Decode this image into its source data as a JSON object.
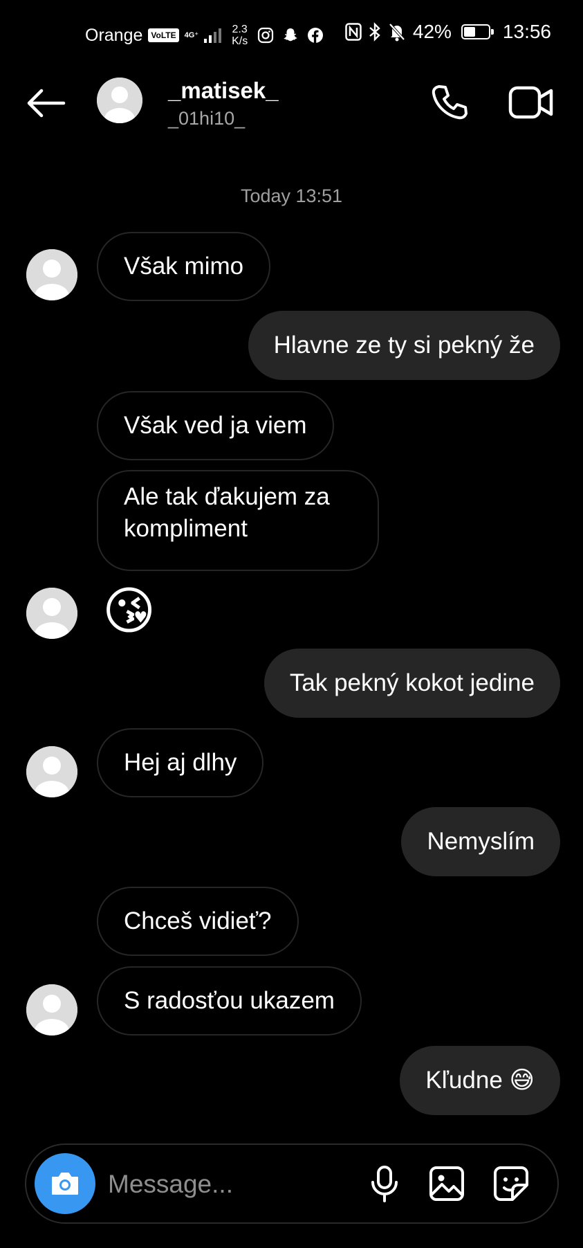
{
  "status_bar": {
    "carrier": "Orange",
    "volte": "VoLTE",
    "network": "4G⁺",
    "speed_value": "2.3",
    "speed_unit": "K/s",
    "battery_percent": "42%",
    "battery_level": 0.42,
    "time": "13:56"
  },
  "header": {
    "name": "_matisek_",
    "username": "_01hi10_"
  },
  "conversation": {
    "timestamp": "Today 13:51",
    "messages": [
      {
        "dir": "in",
        "text": "Však mimo"
      },
      {
        "dir": "out",
        "text": "Hlavne ze ty si pekný že"
      },
      {
        "dir": "in",
        "text": "Však ved ja viem"
      },
      {
        "dir": "in",
        "text": "Ale tak ďakujem za kompliment"
      },
      {
        "dir": "in",
        "text": "😘"
      },
      {
        "dir": "out",
        "text": "Tak pekný kokot jedine"
      },
      {
        "dir": "in",
        "text": "Hej aj dlhy"
      },
      {
        "dir": "out",
        "text": "Nemyslím"
      },
      {
        "dir": "in",
        "text": "Chceš vidieť?"
      },
      {
        "dir": "in",
        "text": "S radosťou ukazem"
      },
      {
        "dir": "out",
        "text": "Kľudne 😅"
      }
    ]
  },
  "composer": {
    "placeholder": "Message..."
  },
  "colors": {
    "background": "#000000",
    "outgoing_bubble": "#262626",
    "camera_button": "#3897f0"
  }
}
